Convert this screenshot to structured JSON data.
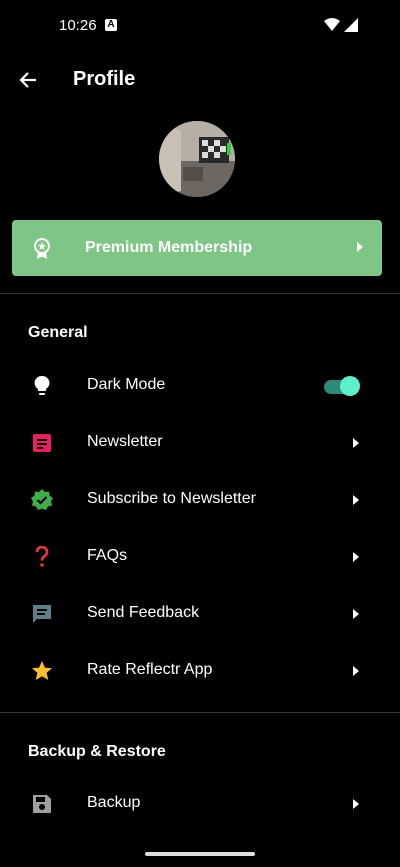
{
  "status_bar": {
    "time": "10:26",
    "notif_letter": "A"
  },
  "appbar": {
    "title": "Profile"
  },
  "premium": {
    "label": "Premium Membership",
    "color": "#7fc686"
  },
  "sections": [
    {
      "title": "General"
    },
    {
      "title": "Backup & Restore"
    }
  ],
  "general_items": [
    {
      "label": "Dark Mode",
      "icon": "lightbulb-icon"
    },
    {
      "label": "Newsletter",
      "icon": "article-icon"
    },
    {
      "label": "Subscribe to Newsletter",
      "icon": "verified-check-icon"
    },
    {
      "label": "FAQs",
      "icon": "question-icon"
    },
    {
      "label": "Send Feedback",
      "icon": "feedback-icon"
    },
    {
      "label": "Rate Reflectr App",
      "icon": "star-icon"
    }
  ],
  "backup_items": [
    {
      "label": "Backup",
      "icon": "save-icon"
    }
  ],
  "dark_mode_enabled": true
}
